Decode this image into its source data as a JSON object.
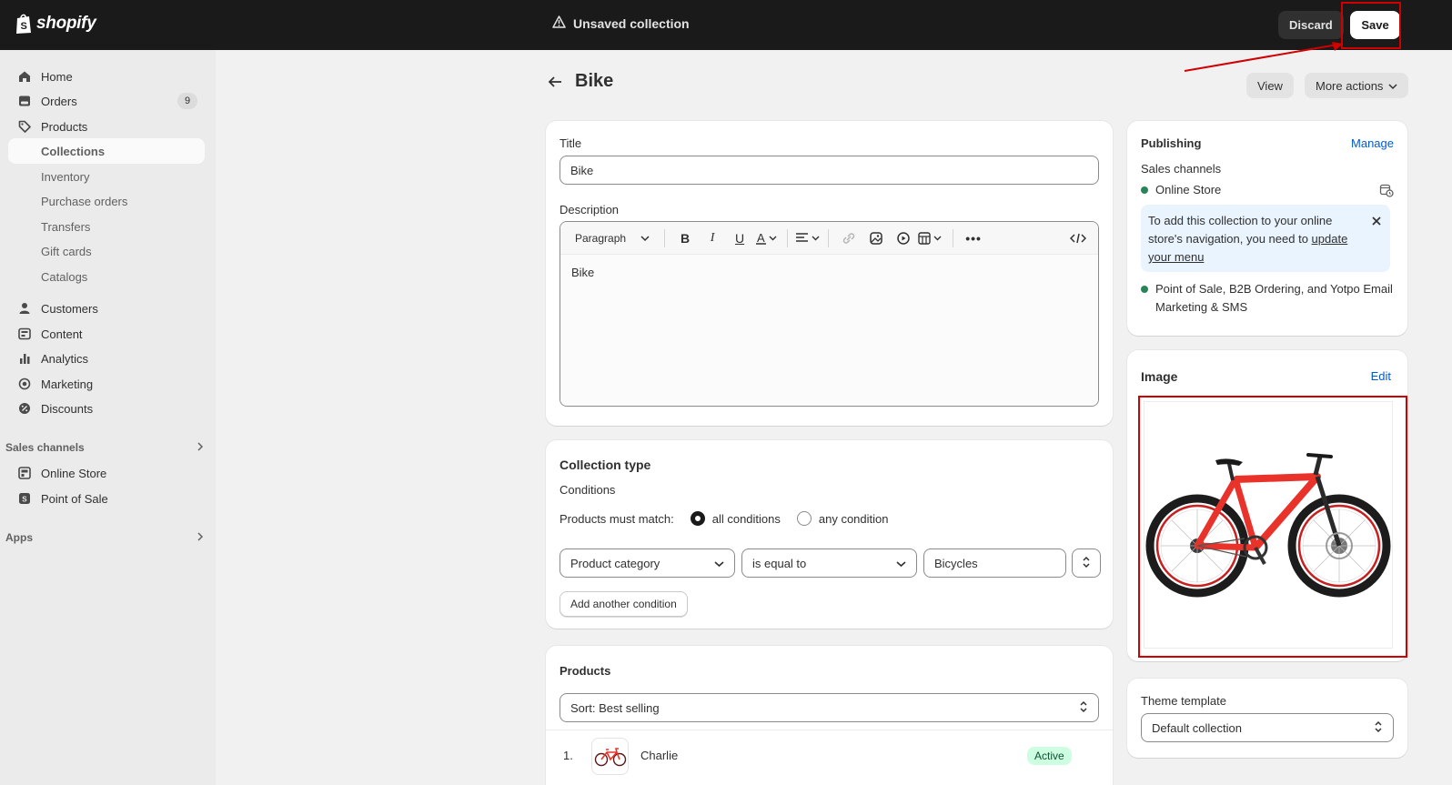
{
  "topbar": {
    "brand": "shopify",
    "status_text": "Unsaved collection",
    "discard_label": "Discard",
    "save_label": "Save"
  },
  "sidebar": {
    "items": [
      {
        "label": "Home",
        "icon": "home-icon"
      },
      {
        "label": "Orders",
        "icon": "orders-icon",
        "badge": "9"
      },
      {
        "label": "Products",
        "icon": "tag-icon"
      },
      {
        "label": "Collections"
      },
      {
        "label": "Inventory"
      },
      {
        "label": "Purchase orders"
      },
      {
        "label": "Transfers"
      },
      {
        "label": "Gift cards"
      },
      {
        "label": "Catalogs"
      },
      {
        "label": "Customers",
        "icon": "person-icon"
      },
      {
        "label": "Content",
        "icon": "content-icon"
      },
      {
        "label": "Analytics",
        "icon": "bar-chart-icon"
      },
      {
        "label": "Marketing",
        "icon": "target-icon"
      },
      {
        "label": "Discounts",
        "icon": "discount-icon"
      }
    ],
    "sales_channels_label": "Sales channels",
    "channels": [
      {
        "label": "Online Store",
        "icon": "store-icon"
      },
      {
        "label": "Point of Sale",
        "icon": "pos-icon"
      }
    ],
    "apps_label": "Apps"
  },
  "page": {
    "title": "Bike",
    "view_label": "View",
    "more_actions_label": "More actions"
  },
  "main_card": {
    "title_label": "Title",
    "title_value": "Bike",
    "description_label": "Description",
    "paragraph_label": "Paragraph",
    "description_value": "Bike"
  },
  "collection_type": {
    "heading": "Collection type",
    "conditions_label": "Conditions",
    "match_label": "Products must match:",
    "all_conditions": "all conditions",
    "any_condition": "any condition",
    "condition_field": "Product category",
    "condition_operator": "is equal to",
    "condition_value": "Bicycles",
    "add_condition_label": "Add another condition"
  },
  "products": {
    "heading": "Products",
    "sort_label": "Sort: Best selling",
    "rows": [
      {
        "index": "1.",
        "name": "Charlie",
        "status": "Active"
      }
    ]
  },
  "publishing": {
    "heading": "Publishing",
    "manage_label": "Manage",
    "sales_channels_label": "Sales channels",
    "online_store_label": "Online Store",
    "banner_text": "To add this collection to your online store's navigation, you need to ",
    "banner_link": "update your menu",
    "other_channels": "Point of Sale, B2B Ordering, and Yotpo Email Marketing & SMS"
  },
  "image_card": {
    "heading": "Image",
    "edit_label": "Edit"
  },
  "theme": {
    "label": "Theme template",
    "value": "Default collection"
  },
  "colors": {
    "topbar": "#1a1a1a",
    "annotation": "#d00000",
    "bike_frame": "#e8322a",
    "status_active": "#cdfee1"
  }
}
